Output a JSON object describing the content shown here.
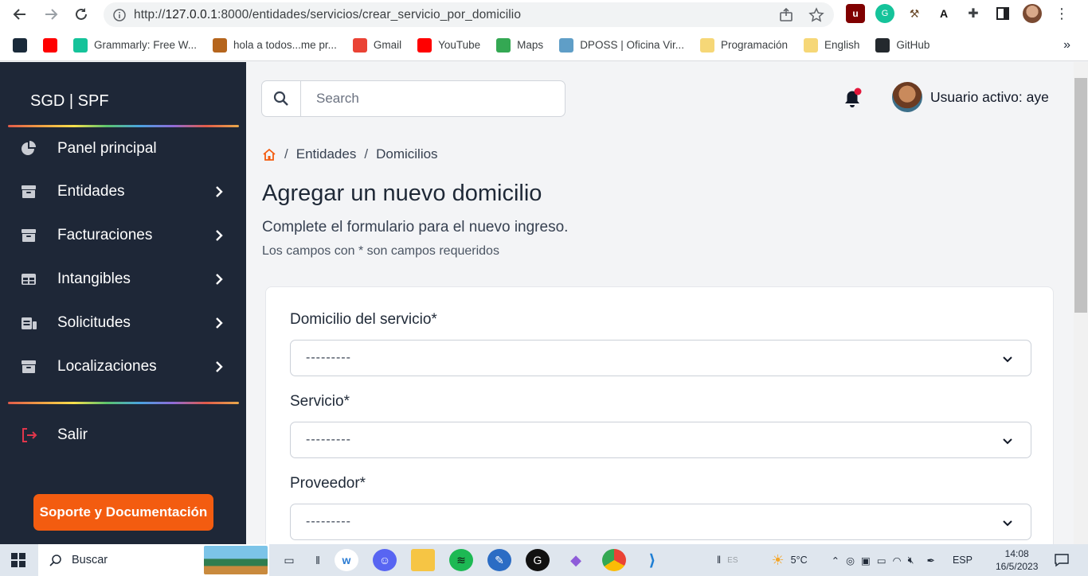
{
  "browser": {
    "url_host": "127.0.0.1",
    "url_rest": ":8000/entidades/servicios/crear_servicio_por_domicilio",
    "url_prefix": "http://",
    "bookmarks": [
      {
        "label": "",
        "icon": "bookmark-l-icon",
        "color": "#1a2a3a"
      },
      {
        "label": "",
        "icon": "youtube-icon",
        "color": "#ff0000"
      },
      {
        "label": "Grammarly: Free W...",
        "icon": "grammarly-icon",
        "color": "#15c39a"
      },
      {
        "label": "hola a todos...me pr...",
        "icon": "character-icon",
        "color": "#b5651d"
      },
      {
        "label": "Gmail",
        "icon": "gmail-icon",
        "color": "#ea4335"
      },
      {
        "label": "YouTube",
        "icon": "youtube-icon",
        "color": "#ff0000"
      },
      {
        "label": "Maps",
        "icon": "maps-pin-icon",
        "color": "#34a853"
      },
      {
        "label": "DPOSS | Oficina Vir...",
        "icon": "globe-icon",
        "color": "#5f9ec7"
      },
      {
        "label": "Programación",
        "icon": "folder-icon",
        "color": "#f6d777"
      },
      {
        "label": "English",
        "icon": "folder-icon",
        "color": "#f6d777"
      },
      {
        "label": "GitHub",
        "icon": "github-icon",
        "color": "#24292e"
      }
    ],
    "more_bookmarks": "»"
  },
  "sidebar": {
    "brand": "SGD | SPF",
    "items": [
      {
        "label": "Panel principal",
        "icon": "pie-chart-icon",
        "has_chevron": false
      },
      {
        "label": "Entidades",
        "icon": "archive-box-icon",
        "has_chevron": true
      },
      {
        "label": "Facturaciones",
        "icon": "archive-box-icon",
        "has_chevron": true
      },
      {
        "label": "Intangibles",
        "icon": "table-icon",
        "has_chevron": true
      },
      {
        "label": "Solicitudes",
        "icon": "id-card-icon",
        "has_chevron": true
      },
      {
        "label": "Localizaciones",
        "icon": "archive-box-icon",
        "has_chevron": true
      }
    ],
    "logout": {
      "label": "Salir",
      "icon": "logout-icon",
      "color": "#e0364b"
    },
    "support_button": "Soporte y Documentación",
    "support_color": "#f35c10"
  },
  "header": {
    "search_placeholder": "Search",
    "user_label": "Usuario activo: aye"
  },
  "breadcrumb": {
    "items": [
      "Entidades",
      "Domicilios"
    ],
    "home_color": "#f35c10"
  },
  "page": {
    "title": "Agregar un nuevo domicilio",
    "subtitle": "Complete el formulario para el nuevo ingreso.",
    "note": "Los campos con * son campos requeridos"
  },
  "form": {
    "fields": [
      {
        "label": "Domicilio del servicio*",
        "value": "---------"
      },
      {
        "label": "Servicio*",
        "value": "---------"
      },
      {
        "label": "Proveedor*",
        "value": "---------"
      }
    ]
  },
  "taskbar": {
    "search_label": "Buscar",
    "weather": "5°C",
    "language": "ESP",
    "time": "14:08",
    "date": "16/5/2023",
    "ime": "ES"
  }
}
